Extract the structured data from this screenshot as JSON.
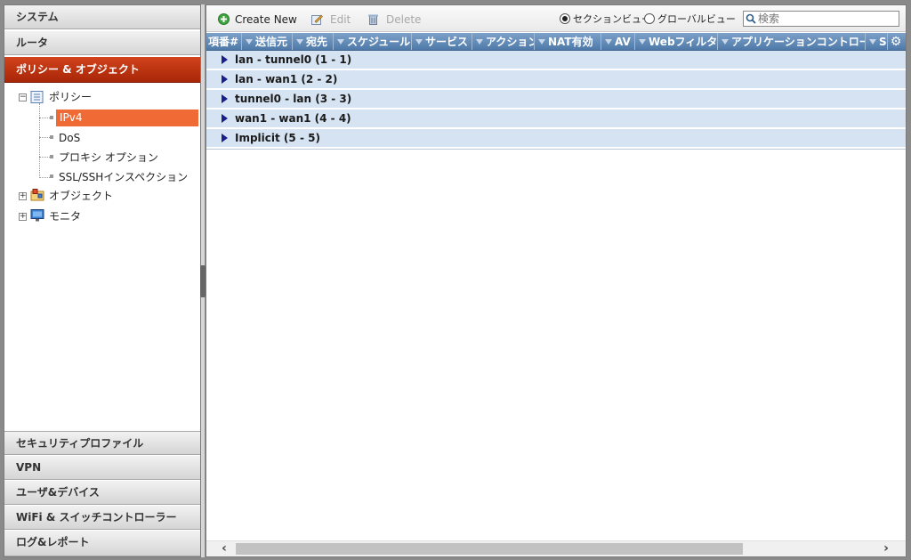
{
  "sidebar": {
    "top_categories": [
      "システム",
      "ルータ"
    ],
    "active_category": "ポリシー & オブジェクト",
    "tree": {
      "policy": "ポリシー",
      "policy_children": [
        "IPv4",
        "DoS",
        "プロキシ オプション",
        "SSL/SSHインスペクション"
      ],
      "objects": "オブジェクト",
      "monitor": "モニタ"
    },
    "bottom_categories": [
      "セキュリティプロファイル",
      "VPN",
      "ユーザ&デバイス",
      "WiFi & スイッチコントローラー",
      "ログ&レポート"
    ]
  },
  "toolbar": {
    "create_label": "Create New",
    "edit_label": "Edit",
    "delete_label": "Delete",
    "view_section": "セクションビュー",
    "view_global": "グローバルビュー",
    "search_placeholder": "検索"
  },
  "table": {
    "columns": [
      "項番#",
      "送信元",
      "宛先",
      "スケジュール",
      "サービス",
      "アクション",
      "NAT有効",
      "AV",
      "Webフィルタ",
      "アプリケーションコントロール",
      "S"
    ],
    "sections": [
      "lan - tunnel0 (1 - 1)",
      "lan - wan1 (2 - 2)",
      "tunnel0 - lan (3 - 3)",
      "wan1 - wan1 (4 - 4)",
      "Implicit (5 - 5)"
    ]
  },
  "colors": {
    "active_category": "#b8300f",
    "selected_item": "#ef6a34",
    "header_blue": "#5a83b0",
    "section_row": "#d6e3f2"
  },
  "icons": [
    "plus-circle-icon",
    "edit-pencil-icon",
    "trash-icon",
    "search-icon",
    "gear-icon",
    "triangle-right-icon",
    "policy-list-icon",
    "objects-icon",
    "monitor-icon"
  ]
}
